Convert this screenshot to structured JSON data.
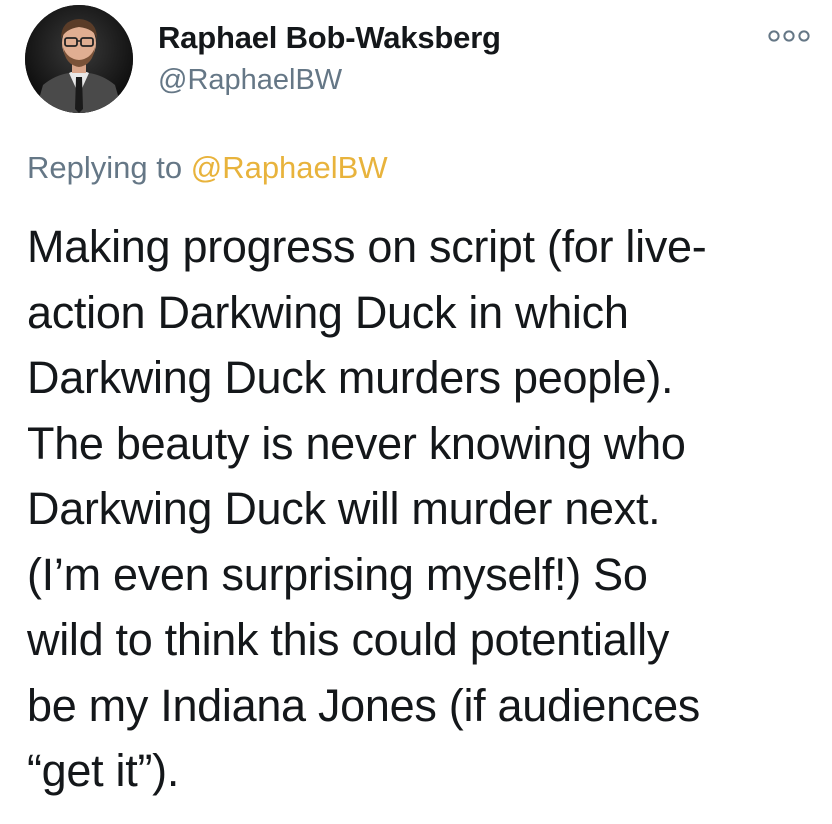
{
  "author": {
    "display_name": "Raphael Bob-Waksberg",
    "handle": "@RaphaelBW",
    "avatar": "profile-photo"
  },
  "more_menu": {
    "icon": "more-options-icon"
  },
  "reply_context": {
    "prefix": "Replying to ",
    "mention": "@RaphaelBW"
  },
  "tweet": {
    "lines": [
      "Making progress on script (for live-",
      "action Darkwing Duck in which",
      "Darkwing Duck murders people).",
      "The beauty is never knowing who",
      "Darkwing Duck will murder next.",
      "(I’m even surprising myself!) So",
      "wild to think this could potentially",
      "be my Indiana Jones (if audiences",
      "“get it”)."
    ]
  },
  "colors": {
    "mention": "#e8b33c",
    "secondary_text": "#657786",
    "primary_text": "#14171a"
  }
}
